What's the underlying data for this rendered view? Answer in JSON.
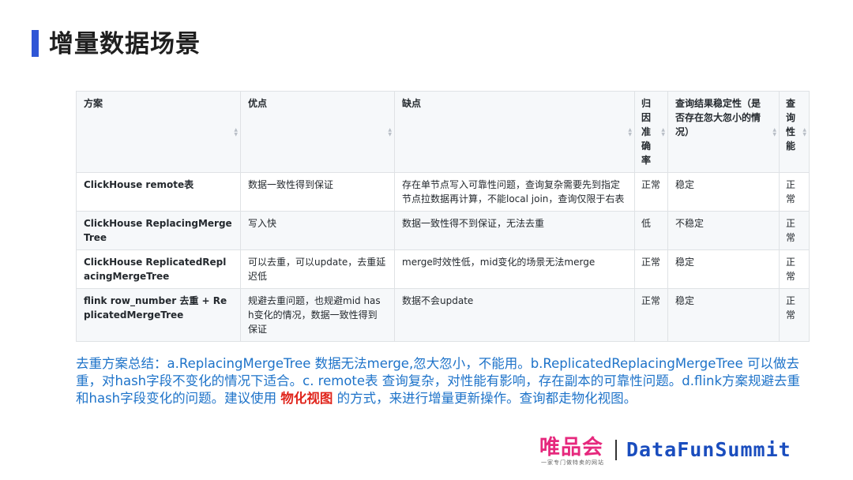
{
  "page": {
    "title": "增量数据场景"
  },
  "table": {
    "headers": [
      "方案",
      "优点",
      "缺点",
      "归因准确率",
      "查询结果稳定性（是否存在忽大忽小的情况）",
      "查询性能"
    ],
    "rows": [
      [
        "ClickHouse remote表",
        "数据一致性得到保证",
        "存在单节点写入可靠性问题，查询复杂需要先到指定节点拉数据再计算，不能local join，查询仅限于右表",
        "正常",
        "稳定",
        "正常"
      ],
      [
        "ClickHouse ReplacingMergeTree",
        "写入快",
        "数据一致性得不到保证，无法去重",
        "低",
        "不稳定",
        "正常"
      ],
      [
        "ClickHouse ReplicatedReplacingMergeTree",
        "可以去重，可以update，去重延迟低",
        "merge时效性低，mid变化的场景无法merge",
        "正常",
        "稳定",
        "正常"
      ],
      [
        "flink row_number 去重 + ReplicatedMergeTree",
        "规避去重问题，也规避mid hash变化的情况，数据一致性得到保证",
        "数据不会update",
        "正常",
        "稳定",
        "正常"
      ]
    ]
  },
  "summary": {
    "before": "去重方案总结：a.ReplacingMergeTree 数据无法merge,忽大忽小，不能用。b.ReplicatedReplacingMergeTree 可以做去重，对hash字段不变化的情况下适合。c. remote表 查询复杂，对性能有影响，存在副本的可靠性问题。d.flink方案规避去重 和hash字段变化的问题。建议使用 ",
    "highlight": "物化视图",
    "after": " 的方式，来进行增量更新操作。查询都走物化视图。"
  },
  "footer": {
    "vip_logo": "唯品会",
    "vip_slogan": "一家专门做特卖的网站",
    "datafun_logo": "DataFunSummit"
  },
  "colors": {
    "accent": "#2f56d6",
    "summary_text": "#1e73c9",
    "highlight": "#e0241b",
    "vip_brand": "#e6287d",
    "datafun_brand": "#1a4dbe"
  }
}
